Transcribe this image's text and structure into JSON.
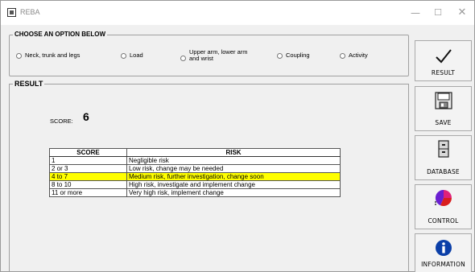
{
  "window": {
    "title": "REBA",
    "minimize_glyph": "—",
    "maximize_glyph": "☐",
    "close_glyph": "✕"
  },
  "options": {
    "heading": "CHOOSE AN OPTION BELOW",
    "items": [
      {
        "label": "Neck, trunk and legs"
      },
      {
        "label": "Load"
      },
      {
        "label": "Upper arm, lower arm and wrist"
      },
      {
        "label": "Coupling"
      },
      {
        "label": "Activity"
      }
    ]
  },
  "result": {
    "heading": "RESULT",
    "score_caption": "SCORE:",
    "score_value": "6",
    "table": {
      "headers": [
        "SCORE",
        "RISK"
      ],
      "rows": [
        {
          "score": "1",
          "risk": "Negligible risk",
          "highlight": false
        },
        {
          "score": "2 or 3",
          "risk": "Low risk, change may be needed",
          "highlight": false
        },
        {
          "score": "4 to 7",
          "risk": "Medium risk, further investigation, change soon",
          "highlight": true
        },
        {
          "score": "8 to 10",
          "risk": "High risk, investigate and implement change",
          "highlight": false
        },
        {
          "score": "11 or more",
          "risk": "Very high risk, implement change",
          "highlight": false
        }
      ],
      "highlight_color": "#ffff00"
    }
  },
  "sidebar": {
    "buttons": [
      {
        "label": "RESULT",
        "icon": "checkmark-icon"
      },
      {
        "label": "SAVE",
        "icon": "floppy-disk-icon"
      },
      {
        "label": "DATABASE",
        "icon": "cabinet-icon"
      },
      {
        "label": "CONTROL",
        "icon": "pie-chart-icon"
      },
      {
        "label": "INFORMATION",
        "icon": "info-icon"
      }
    ]
  }
}
